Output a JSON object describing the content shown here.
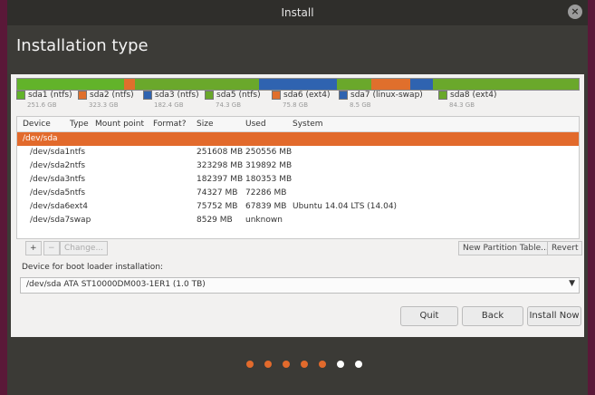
{
  "window": {
    "title": "Install",
    "close_glyph": "×"
  },
  "header": {
    "title": "Installation type"
  },
  "partition_bar": [
    {
      "color": "#62b32a",
      "share": 0.19
    },
    {
      "color": "#e06f2c",
      "share": 0.02
    },
    {
      "color": "#6aa82b",
      "share": 0.22
    },
    {
      "color": "#2f63b0",
      "share": 0.14
    },
    {
      "color": "#6aa82b",
      "share": 0.06
    },
    {
      "color": "#e06f2c",
      "share": 0.07
    },
    {
      "color": "#2f63b0",
      "share": 0.04
    },
    {
      "color": "#6aa82b",
      "share": 0.26
    }
  ],
  "legend": [
    {
      "label": "sda1 (ntfs)",
      "size": "251.6 GB",
      "color": "#62b32a"
    },
    {
      "label": "sda2 (ntfs)",
      "size": "323.3 GB",
      "color": "#e06f2c"
    },
    {
      "label": "sda3 (ntfs)",
      "size": "182.4 GB",
      "color": "#2f63b0"
    },
    {
      "label": "sda5 (ntfs)",
      "size": "74.3 GB",
      "color": "#6aa82b"
    },
    {
      "label": "sda6 (ext4)",
      "size": "75.8 GB",
      "color": "#e06f2c"
    },
    {
      "label": "sda7 (linux-swap)",
      "size": "8.5 GB",
      "color": "#2f63b0"
    },
    {
      "label": "sda8 (ext4)",
      "size": "84.3 GB",
      "color": "#6aa82b"
    }
  ],
  "table": {
    "headers": [
      "Device",
      "Type",
      "Mount point",
      "Format?",
      "Size",
      "Used",
      "System"
    ],
    "rows": [
      {
        "device": "/dev/sda",
        "type": "",
        "size": "",
        "used": "",
        "system": ""
      },
      {
        "device": "/dev/sda1",
        "type": "ntfs",
        "size": "251608 MB",
        "used": "250556 MB",
        "system": ""
      },
      {
        "device": "/dev/sda2",
        "type": "ntfs",
        "size": "323298 MB",
        "used": "319892 MB",
        "system": ""
      },
      {
        "device": "/dev/sda3",
        "type": "ntfs",
        "size": "182397 MB",
        "used": "180353 MB",
        "system": ""
      },
      {
        "device": "/dev/sda5",
        "type": "ntfs",
        "size": "74327 MB",
        "used": "72286 MB",
        "system": ""
      },
      {
        "device": "/dev/sda6",
        "type": "ext4",
        "size": "75752 MB",
        "used": "67839 MB",
        "system": "Ubuntu 14.04 LTS (14.04)"
      },
      {
        "device": "/dev/sda7",
        "type": "swap",
        "size": "8529 MB",
        "used": "unknown",
        "system": ""
      }
    ]
  },
  "tools": {
    "add": "+",
    "remove": "−",
    "change": "Change...",
    "new_table": "New Partition Table...",
    "revert": "Revert"
  },
  "boot": {
    "label": "Device for boot loader installation:",
    "value": "/dev/sda   ATA ST10000DM003-1ER1 (1.0 TB)",
    "arrow": "▼"
  },
  "actions": {
    "quit": "Quit",
    "back": "Back",
    "install": "Install Now"
  },
  "progress_dots": [
    "#e26a2c",
    "#e26a2c",
    "#e26a2c",
    "#e26a2c",
    "#e26a2c",
    "#ffffff",
    "#ffffff"
  ],
  "colors": {
    "accent": "#e26a2c",
    "window_bg": "#3b3a36",
    "content_bg": "#f2f1f0"
  }
}
